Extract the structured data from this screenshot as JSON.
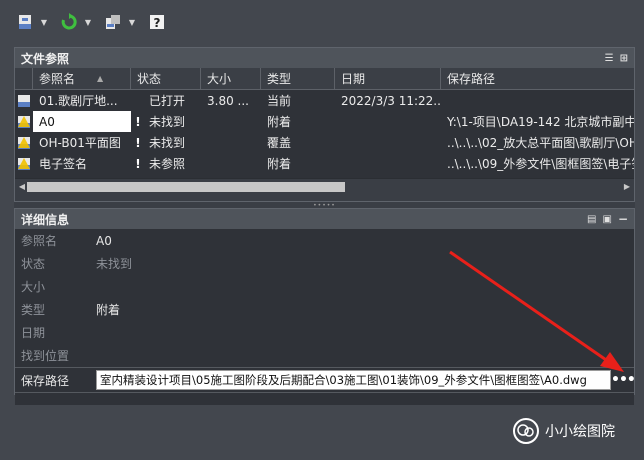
{
  "toolbar": {
    "buttons": [
      {
        "icon": "attach-dwg-icon"
      },
      {
        "icon": "refresh-icon"
      },
      {
        "icon": "change-path-icon"
      },
      {
        "icon": "help-icon"
      }
    ]
  },
  "file_refs": {
    "title": "文件参照",
    "columns": [
      "参照名",
      "状态",
      "大小",
      "类型",
      "日期",
      "保存路径"
    ],
    "rows": [
      {
        "name": "01.歌剧厅地...",
        "flag": "",
        "status": "已打开",
        "size": "3.80 ...",
        "type": "当前",
        "date": "2022/3/3 11:22...",
        "path": ""
      },
      {
        "name": "A0",
        "flag": "!",
        "status": "未找到",
        "size": "",
        "type": "附着",
        "date": "",
        "path": "Y:\\1-项目\\DA19-142 北京城市副中"
      },
      {
        "name": "OH-B01平面图",
        "flag": "!",
        "status": "未找到",
        "size": "",
        "type": "覆盖",
        "date": "",
        "path": "..\\..\\..\\02_放大总平面图\\歌剧厅\\OH"
      },
      {
        "name": "电子签名",
        "flag": "!",
        "status": "未参照",
        "size": "",
        "type": "附着",
        "date": "",
        "path": "..\\..\\..\\09_外参文件\\图框图签\\电子签"
      }
    ]
  },
  "details": {
    "title": "详细信息",
    "fields": [
      {
        "label": "参照名",
        "value": "A0"
      },
      {
        "label": "状态",
        "value": "未找到"
      },
      {
        "label": "大小",
        "value": ""
      },
      {
        "label": "类型",
        "value": "附着"
      },
      {
        "label": "日期",
        "value": ""
      },
      {
        "label": "找到位置",
        "value": ""
      }
    ],
    "saved_path_label": "保存路径",
    "saved_path_value": "室内精装设计项目\\05施工图阶段及后期配合\\03施工图\\01装饰\\09_外参文件\\图框图签\\A0.dwg",
    "browse_label": "•••"
  },
  "watermark": {
    "text": "小小绘图院"
  },
  "colors": {
    "accent_green": "#3fbf3f",
    "arrow_red": "#e8201a",
    "panel_bg": "#3a3e45"
  }
}
